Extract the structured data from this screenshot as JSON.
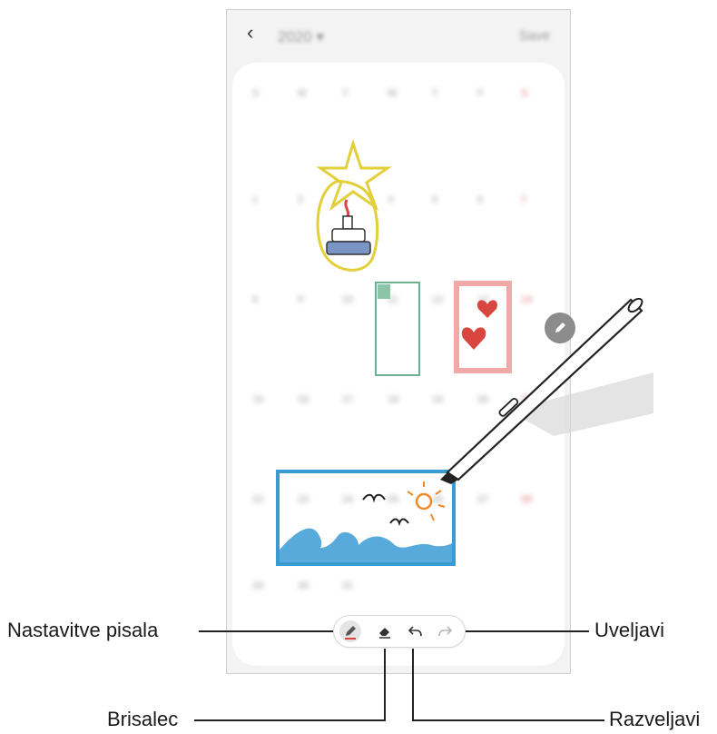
{
  "app": {
    "back_glyph": "‹",
    "title_blurred": "2020 ▾",
    "action_blurred": "Save"
  },
  "calendar_blurred": {
    "row0": [
      "S",
      "M",
      "T",
      "W",
      "T",
      "F",
      "S"
    ],
    "row0_sub": [
      "",
      "",
      "",
      "",
      "",
      "",
      ""
    ],
    "rows": [
      [
        "1",
        "2",
        "3",
        "4",
        "5",
        "6",
        "7"
      ],
      [
        "8",
        "9",
        "10",
        "11",
        "12",
        "13",
        "14"
      ],
      [
        "15",
        "16",
        "17",
        "18",
        "19",
        "20",
        "21"
      ],
      [
        "22",
        "23",
        "24",
        "25",
        "26",
        "27",
        "28"
      ],
      [
        "29",
        "30",
        "31",
        "",
        "",
        "",
        ""
      ]
    ]
  },
  "toolbar": {
    "pen_settings_icon": "pen-icon",
    "eraser_icon": "eraser-icon",
    "undo_icon": "undo-icon",
    "redo_icon": "redo-icon"
  },
  "callouts": {
    "pen_settings": "Nastavitve pisala",
    "eraser": "Brisalec",
    "redo": "Uveljavi",
    "undo": "Razveljavi"
  },
  "colors": {
    "line": "#222222",
    "accent_red": "#d9453f",
    "sketch_blue": "#3a9bd2",
    "sketch_yellow": "#e2cf3a",
    "sketch_pink": "#f0a9a7",
    "sketch_green": "#6fb092"
  }
}
